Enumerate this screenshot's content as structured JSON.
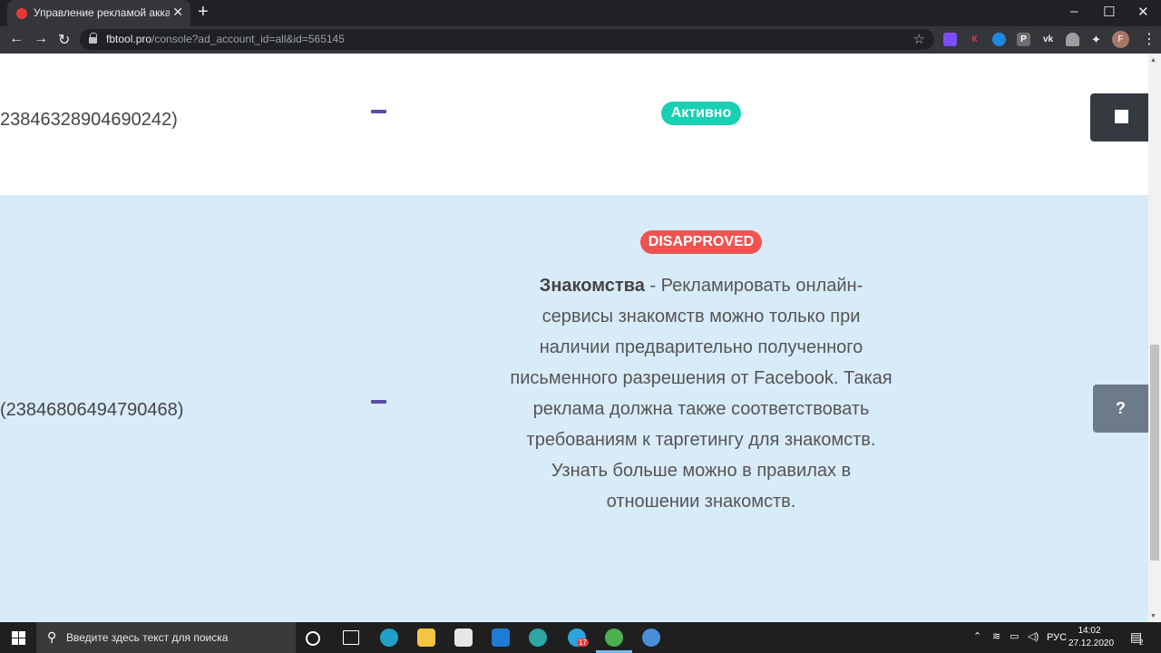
{
  "browser": {
    "tab_title": "Управление рекламой аккаунта",
    "tab_close": "✕",
    "new_tab": "+",
    "window_minimize": "–",
    "window_maximize": "☐",
    "window_close": "✕",
    "back": "←",
    "forward": "→",
    "reload": "↻",
    "url_host": "fbtool.pro",
    "url_path": "/console?ad_account_id=all&id=565145",
    "star": "☆",
    "extensions": [
      {
        "name": "ext-purple",
        "label": "",
        "color": "#7c4dff"
      },
      {
        "name": "ext-k",
        "label": "К",
        "color": "#35363a"
      },
      {
        "name": "ext-blue",
        "label": "",
        "color": "#1e88e5"
      },
      {
        "name": "ext-p",
        "label": "P",
        "color": "#6d6d6d"
      },
      {
        "name": "ext-vk",
        "label": "vk",
        "color": "#35363a"
      },
      {
        "name": "ext-arc",
        "label": "",
        "color": "#9e9e9e"
      },
      {
        "name": "ext-puzzle",
        "label": "✦",
        "color": "#35363a"
      }
    ],
    "profile_letter": "F",
    "menu": "⋮"
  },
  "rows": [
    {
      "ad_id": "23846328904690242)",
      "status": "Активно",
      "status_color": "#19cfb4"
    },
    {
      "ad_id": "(23846806494790468)",
      "status": "DISAPPROVED",
      "status_color": "#ef5350",
      "reason_title": "Знакомства",
      "reason_text": " - Рекламировать онлайн-сервисы знакомств можно только при наличии предварительно полученного письменного разрешения от Facebook. Такая реклама должна также соответствовать требованиям к таргетингу для знакомств. Узнать больше можно в правилах в отношении знакомств."
    }
  ],
  "buttons": {
    "help": "?"
  },
  "taskbar": {
    "search_placeholder": "Введите здесь текст для поиска",
    "apps": [
      "cortana-icon",
      "task-view-icon",
      "edge-icon",
      "file-explorer-icon",
      "store-icon",
      "mail-icon",
      "edge-dev-icon",
      "telegram-icon",
      "chrome-icon",
      "chrome-alt-icon"
    ],
    "telegram_badge": "17",
    "language": "РУС",
    "time": "14:02",
    "date": "27.12.2020",
    "notifications": "2"
  }
}
